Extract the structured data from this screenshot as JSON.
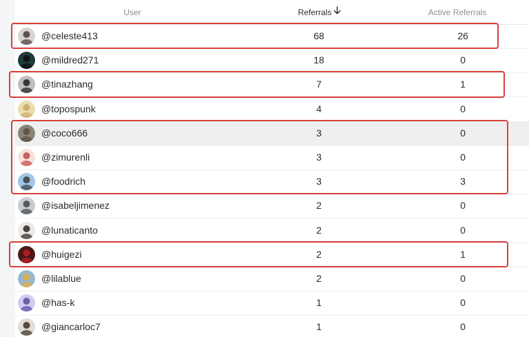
{
  "table": {
    "headers": {
      "user": "User",
      "referrals": "Referrals",
      "active_referrals": "Active Referrals"
    },
    "sort": {
      "column": "referrals",
      "direction": "descending",
      "icon": "arrow-down-icon"
    },
    "rows": [
      {
        "user": "@celeste413",
        "referrals": "68",
        "active": "26",
        "avatar_color": "#d8d4d0",
        "avatar_accent": "#4a3c38",
        "highlighted": false
      },
      {
        "user": "@mildred271",
        "referrals": "18",
        "active": "0",
        "avatar_color": "#1f3a3a",
        "avatar_accent": "#0c0f10",
        "highlighted": false
      },
      {
        "user": "@tinazhang",
        "referrals": "7",
        "active": "1",
        "avatar_color": "#bdbdbd",
        "avatar_accent": "#1c1c1c",
        "highlighted": false
      },
      {
        "user": "@topospunk",
        "referrals": "4",
        "active": "0",
        "avatar_color": "#e8dfae",
        "avatar_accent": "#c9a86a",
        "highlighted": false
      },
      {
        "user": "@coco666",
        "referrals": "3",
        "active": "0",
        "avatar_color": "#8a8478",
        "avatar_accent": "#5b4a3e",
        "highlighted": true
      },
      {
        "user": "@zimurenli",
        "referrals": "3",
        "active": "0",
        "avatar_color": "#f6e4dc",
        "avatar_accent": "#c24a4a",
        "highlighted": false
      },
      {
        "user": "@foodrich",
        "referrals": "3",
        "active": "3",
        "avatar_color": "#9fc6e6",
        "avatar_accent": "#3a3a3a",
        "highlighted": false
      },
      {
        "user": "@isabeljimenez",
        "referrals": "2",
        "active": "0",
        "avatar_color": "#c8ccd0",
        "avatar_accent": "#3e444a",
        "highlighted": false
      },
      {
        "user": "@lunaticanto",
        "referrals": "2",
        "active": "0",
        "avatar_color": "#ece8e6",
        "avatar_accent": "#2c2624",
        "highlighted": false
      },
      {
        "user": "@huigezi",
        "referrals": "2",
        "active": "1",
        "avatar_color": "#4a1818",
        "avatar_accent": "#c22020",
        "highlighted": false
      },
      {
        "user": "@lilablue",
        "referrals": "2",
        "active": "0",
        "avatar_color": "#9ab6cc",
        "avatar_accent": "#e0b040",
        "highlighted": false
      },
      {
        "user": "@has-k",
        "referrals": "1",
        "active": "0",
        "avatar_color": "#d4ccf0",
        "avatar_accent": "#5a4aa0",
        "highlighted": false
      },
      {
        "user": "@giancarloc7",
        "referrals": "1",
        "active": "0",
        "avatar_color": "#e2dcd4",
        "avatar_accent": "#3a2e28",
        "highlighted": false
      }
    ]
  },
  "annotations": {
    "color": "#d6403a",
    "groups": [
      {
        "rows": [
          "@celeste413"
        ]
      },
      {
        "rows": [
          "@tinazhang"
        ]
      },
      {
        "rows": [
          "@coco666",
          "@zimurenli",
          "@foodrich"
        ]
      },
      {
        "rows": [
          "@huigezi"
        ]
      }
    ]
  }
}
